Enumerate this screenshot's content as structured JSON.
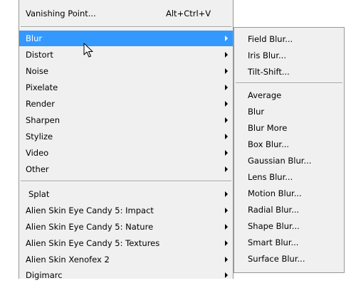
{
  "menu": {
    "vanishing_point": {
      "label": "Vanishing Point...",
      "shortcut": "Alt+Ctrl+V"
    },
    "items": [
      {
        "label": "Blur"
      },
      {
        "label": "Distort"
      },
      {
        "label": "Noise"
      },
      {
        "label": "Pixelate"
      },
      {
        "label": "Render"
      },
      {
        "label": "Sharpen"
      },
      {
        "label": "Stylize"
      },
      {
        "label": "Video"
      },
      {
        "label": "Other"
      }
    ],
    "plugins": [
      {
        "label": "Splat"
      },
      {
        "label": "Alien Skin Eye Candy 5: Impact"
      },
      {
        "label": "Alien Skin Eye Candy 5: Nature"
      },
      {
        "label": "Alien Skin Eye Candy 5: Textures"
      },
      {
        "label": "Alien Skin Xenofex 2"
      },
      {
        "label": "Digimarc"
      }
    ]
  },
  "submenu": {
    "gallery": [
      {
        "label": "Field Blur..."
      },
      {
        "label": "Iris Blur..."
      },
      {
        "label": "Tilt-Shift..."
      }
    ],
    "filters": [
      {
        "label": "Average"
      },
      {
        "label": "Blur"
      },
      {
        "label": "Blur More"
      },
      {
        "label": "Box Blur..."
      },
      {
        "label": "Gaussian Blur..."
      },
      {
        "label": "Lens Blur..."
      },
      {
        "label": "Motion Blur..."
      },
      {
        "label": "Radial Blur..."
      },
      {
        "label": "Shape Blur..."
      },
      {
        "label": "Smart Blur..."
      },
      {
        "label": "Surface Blur..."
      }
    ]
  },
  "icons": {
    "cursor": "mouse-pointer-icon",
    "submenu_arrow": "chevron-right-icon"
  },
  "colors": {
    "highlight": "#3399ff",
    "menu_bg": "#f0f0f0",
    "border": "#979797"
  }
}
